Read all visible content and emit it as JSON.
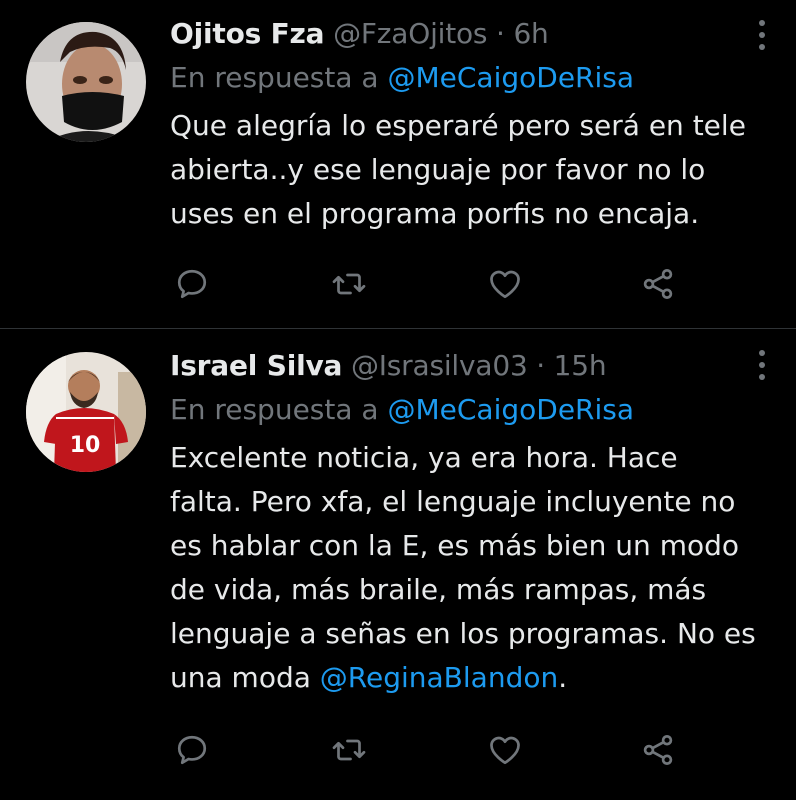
{
  "tweets": [
    {
      "name": "Ojitos Fza",
      "handle": "@FzaOjitos",
      "separator": "·",
      "time": "6h",
      "reply_prefix": "En respuesta a",
      "reply_to": "@MeCaigoDeRisa",
      "text": "Que alegría lo esperaré pero será en tele abierta..y ese lenguaje por favor no lo uses en el programa porfis no encaja.",
      "text_mention": ""
    },
    {
      "name": "Israel Silva",
      "handle": "@Israsilva03",
      "separator": "·",
      "time": "15h",
      "reply_prefix": "En respuesta a",
      "reply_to": "@MeCaigoDeRisa",
      "text": "Excelente noticia, ya era hora. Hace falta. Pero xfa, el lenguaje incluyente no es hablar con la E, es más bien un modo de vida, más braile, más rampas, más lenguaje a señas en los programas. No es una moda ",
      "text_mention": "@ReginaBlandon",
      "text_end": "."
    }
  ],
  "colors": {
    "background": "#000000",
    "text": "#e7e9ea",
    "secondary": "#71767b",
    "accent": "#1d9bf0",
    "divider": "#2f3336"
  },
  "icons": [
    "reply-icon",
    "retweet-icon",
    "like-icon",
    "share-icon",
    "more-icon"
  ]
}
